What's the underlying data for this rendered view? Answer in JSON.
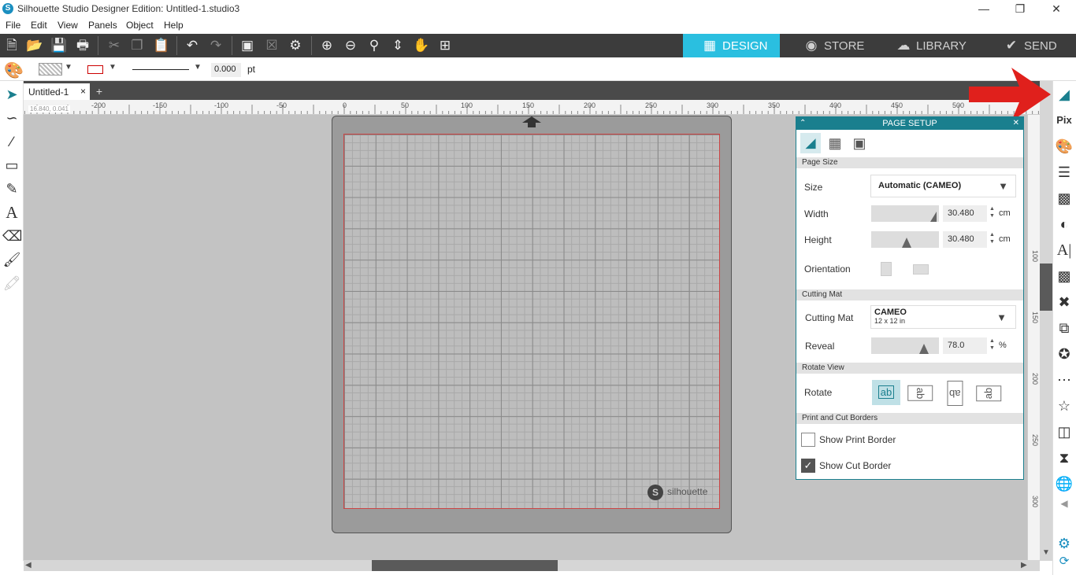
{
  "window": {
    "title": "Silhouette Studio Designer Edition: Untitled-1.studio3",
    "minimize": "—",
    "restore": "❐",
    "close": "✕"
  },
  "menus": [
    "File",
    "Edit",
    "View",
    "Panels",
    "Object",
    "Help"
  ],
  "nav": {
    "design": "DESIGN",
    "store": "STORE",
    "library": "LIBRARY",
    "send": "SEND"
  },
  "props": {
    "line_weight": "0.000",
    "unit": "pt"
  },
  "doc_tab": {
    "label": "Untitled-1",
    "close": "×",
    "add": "+"
  },
  "coords": {
    "x": "16.840",
    "y": "0.041"
  },
  "ruler_h": [
    "-200",
    "-150",
    "-100",
    "-50",
    "0",
    "50",
    "100",
    "150",
    "200",
    "250",
    "300",
    "350",
    "400",
    "450",
    "500"
  ],
  "ruler_v": [
    "100",
    "150",
    "200",
    "250",
    "300"
  ],
  "mat": {
    "brand": "silhouette"
  },
  "page_setup": {
    "title": "PAGE SETUP",
    "page_size_section": "Page Size",
    "size_label": "Size",
    "size_value": "Automatic (CAMEO)",
    "width_label": "Width",
    "width_value": "30.480",
    "height_label": "Height",
    "height_value": "30.480",
    "unit": "cm",
    "orientation_label": "Orientation",
    "cutting_mat_section": "Cutting Mat",
    "cutting_mat_label": "Cutting Mat",
    "cutting_mat_value": "CAMEO",
    "cutting_mat_sub": "12 x 12 in",
    "reveal_label": "Reveal",
    "reveal_value": "78.0",
    "reveal_unit": "%",
    "rotate_section": "Rotate View",
    "rotate_label": "Rotate",
    "rotate_options": [
      "ab",
      "ab",
      "ab",
      "ab"
    ],
    "borders_section": "Print and Cut Borders",
    "show_print_border": "Show Print Border",
    "show_print_border_checked": false,
    "show_cut_border": "Show Cut Border",
    "show_cut_border_checked": true
  },
  "colors": {
    "accent": "#1a7f8e",
    "design_tab": "#2abfe0",
    "toolbar": "#3c3c3c",
    "arrow": "#e0201c",
    "cut_line": "#cc4444"
  }
}
